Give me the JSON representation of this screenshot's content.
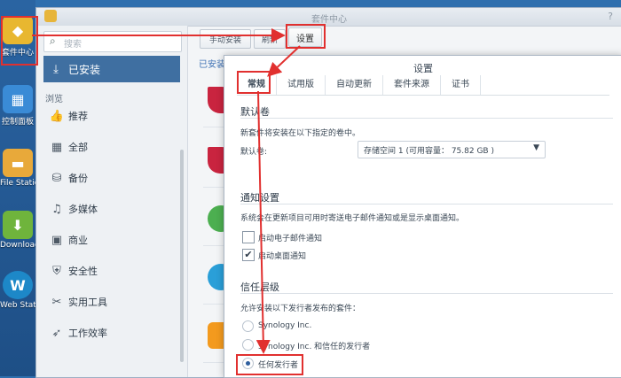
{
  "desktop": {
    "icons": [
      {
        "name": "package-center",
        "label": "套件中心"
      },
      {
        "name": "control-panel",
        "label": "控制面板"
      },
      {
        "name": "file-station",
        "label": "File Station"
      },
      {
        "name": "download-station",
        "label": "Download Station"
      },
      {
        "name": "web-station",
        "label": "Web Station"
      }
    ]
  },
  "window": {
    "title": "套件中心",
    "help": "?"
  },
  "sidebar": {
    "search_placeholder": "搜索",
    "installed_label": "已安装",
    "browse_header": "浏览",
    "items": [
      {
        "label": "推荐",
        "icon": "thumbs-up-icon"
      },
      {
        "label": "全部",
        "icon": "grid-icon"
      },
      {
        "label": "备份",
        "icon": "backup-icon"
      },
      {
        "label": "多媒体",
        "icon": "media-icon"
      },
      {
        "label": "商业",
        "icon": "briefcase-icon"
      },
      {
        "label": "安全性",
        "icon": "shield-icon"
      },
      {
        "label": "实用工具",
        "icon": "tools-icon"
      },
      {
        "label": "工作效率",
        "icon": "rocket-icon"
      }
    ]
  },
  "toolbar": {
    "manual_install": "手动安装",
    "refresh": "刷新",
    "settings": "设置"
  },
  "main": {
    "installed_tab": "已安装"
  },
  "settings_dialog": {
    "title": "设置",
    "tabs": [
      "常规",
      "试用版",
      "自动更新",
      "套件来源",
      "证书"
    ],
    "default_volume": {
      "section": "默认卷",
      "desc": "新套件将安装在以下指定的卷中。",
      "label": "默认卷:",
      "value": "存储空间 1 (可用容量： 75.82 GB )"
    },
    "notification": {
      "section": "通知设置",
      "desc": "系统会在更新项目可用时寄送电子邮件通知或是显示桌面通知。",
      "email": "启动电子邮件通知",
      "email_checked": false,
      "desktop": "启动桌面通知",
      "desktop_checked": true
    },
    "trust": {
      "section": "信任层级",
      "desc": "允许安装以下发行者发布的套件：",
      "options": [
        "Synology Inc.",
        "Synology Inc. 和信任的发行者",
        "任何发行者"
      ],
      "selected_index": 2
    }
  }
}
